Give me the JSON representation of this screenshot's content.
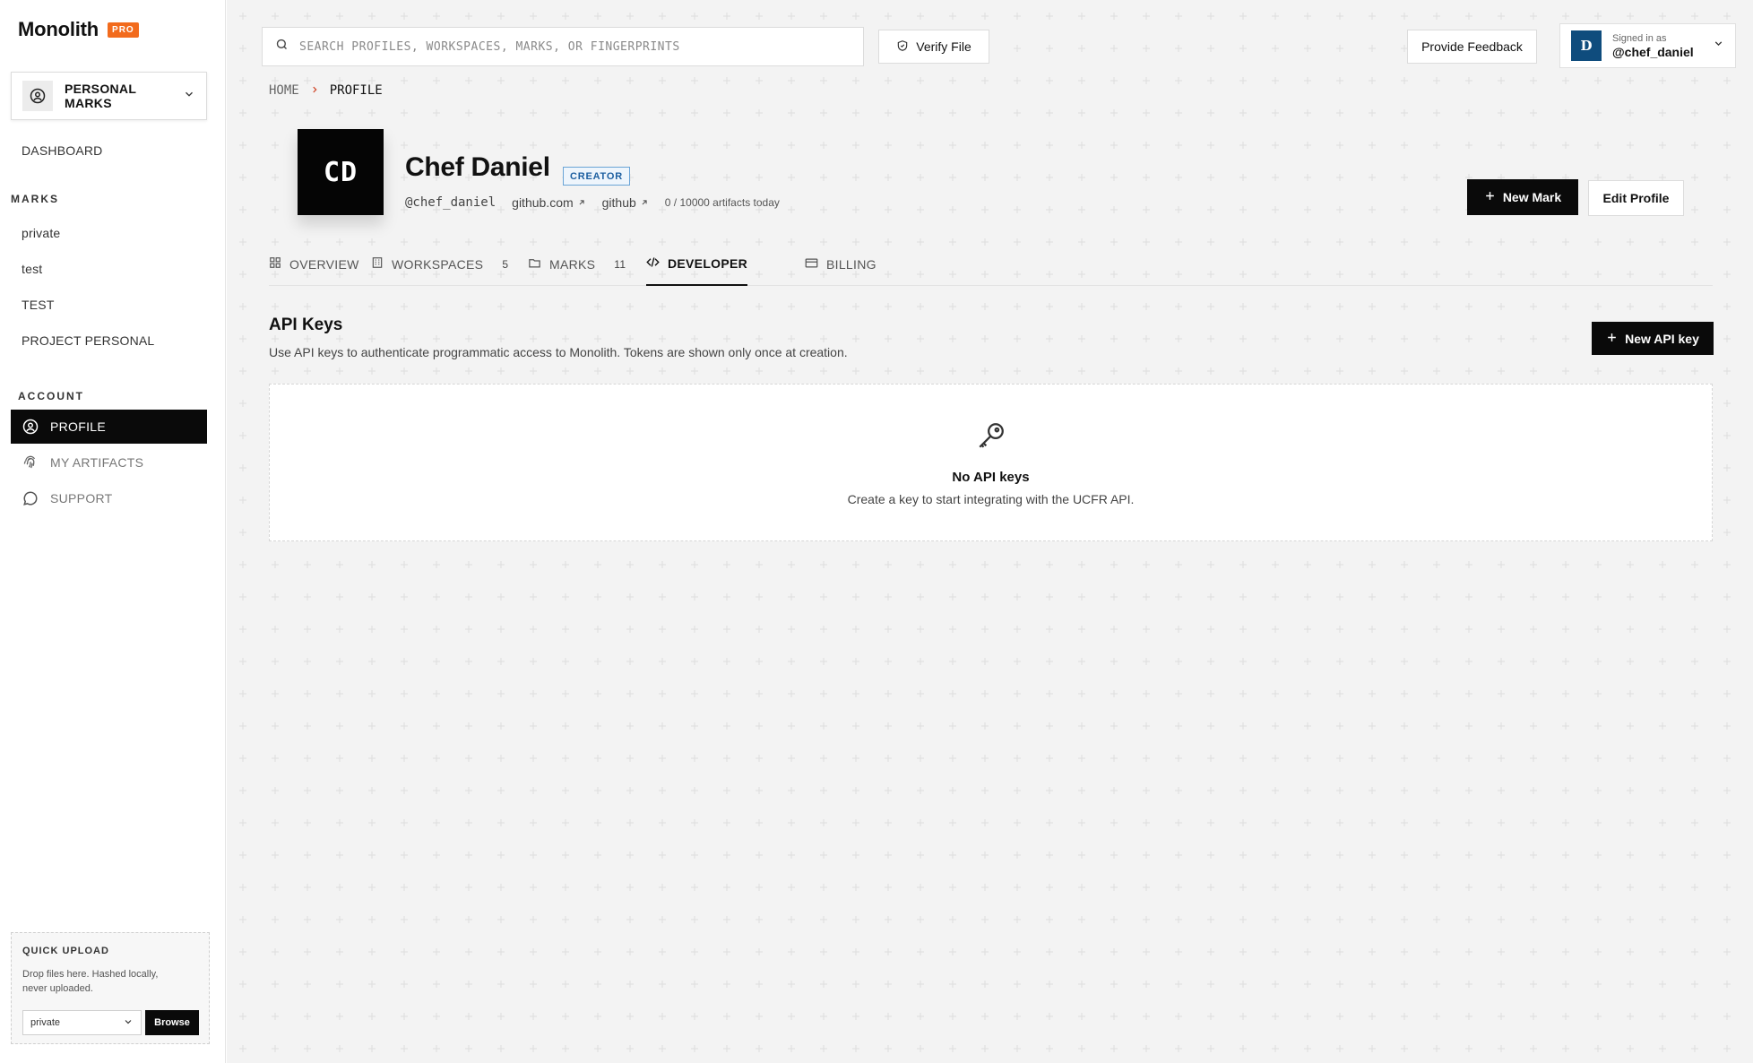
{
  "brand": {
    "name": "Monolith",
    "badge": "PRO"
  },
  "sidebar": {
    "switcher_label": "PERSONAL MARKS",
    "dashboard": "DASHBOARD",
    "marks_heading": "MARKS",
    "marks": [
      "private",
      "test",
      "TEST",
      "PROJECT PERSONAL"
    ],
    "account_heading": "ACCOUNT",
    "account_items": [
      {
        "label": "PROFILE",
        "icon": "user-circle-icon",
        "active": true
      },
      {
        "label": "MY ARTIFACTS",
        "icon": "fingerprint-icon",
        "active": false
      },
      {
        "label": "SUPPORT",
        "icon": "chat-bubble-icon",
        "active": false
      }
    ],
    "quick_upload": {
      "title": "QUICK UPLOAD",
      "description": "Drop files here. Hashed locally, never uploaded.",
      "select_value": "private",
      "browse_label": "Browse"
    }
  },
  "header": {
    "search_placeholder": "SEARCH PROFILES, WORKSPACES, MARKS, OR FINGERPRINTS",
    "verify_label": "Verify File",
    "feedback_label": "Provide Feedback",
    "user": {
      "initial": "D",
      "signed_in_label": "Signed in as",
      "handle": "@chef_daniel"
    }
  },
  "breadcrumb": {
    "home": "HOME",
    "current": "PROFILE"
  },
  "profile": {
    "initials": "CD",
    "name": "Chef Daniel",
    "role_badge": "CREATOR",
    "handle": "@chef_daniel",
    "links": [
      "github.com",
      "github"
    ],
    "quota": "0 / 10000 artifacts today",
    "new_mark_label": "New Mark",
    "edit_label": "Edit Profile"
  },
  "tabs": [
    {
      "label": "OVERVIEW",
      "count": ""
    },
    {
      "label": "WORKSPACES",
      "count": "5"
    },
    {
      "label": "MARKS",
      "count": "11"
    },
    {
      "label": "DEVELOPER",
      "count": ""
    },
    {
      "label": "BILLING",
      "count": ""
    }
  ],
  "api_keys": {
    "title": "API Keys",
    "description": "Use API keys to authenticate programmatic access to Monolith. Tokens are shown only once at creation.",
    "new_key_label": "New API key",
    "empty_title": "No API keys",
    "empty_description": "Create a key to start integrating with the UCFR API."
  },
  "colors": {
    "accent": "#f26b1d",
    "dark": "#0a0a0a",
    "avatar_blue": "#0f4c7d",
    "badge_blue": "#1d5fa0"
  }
}
